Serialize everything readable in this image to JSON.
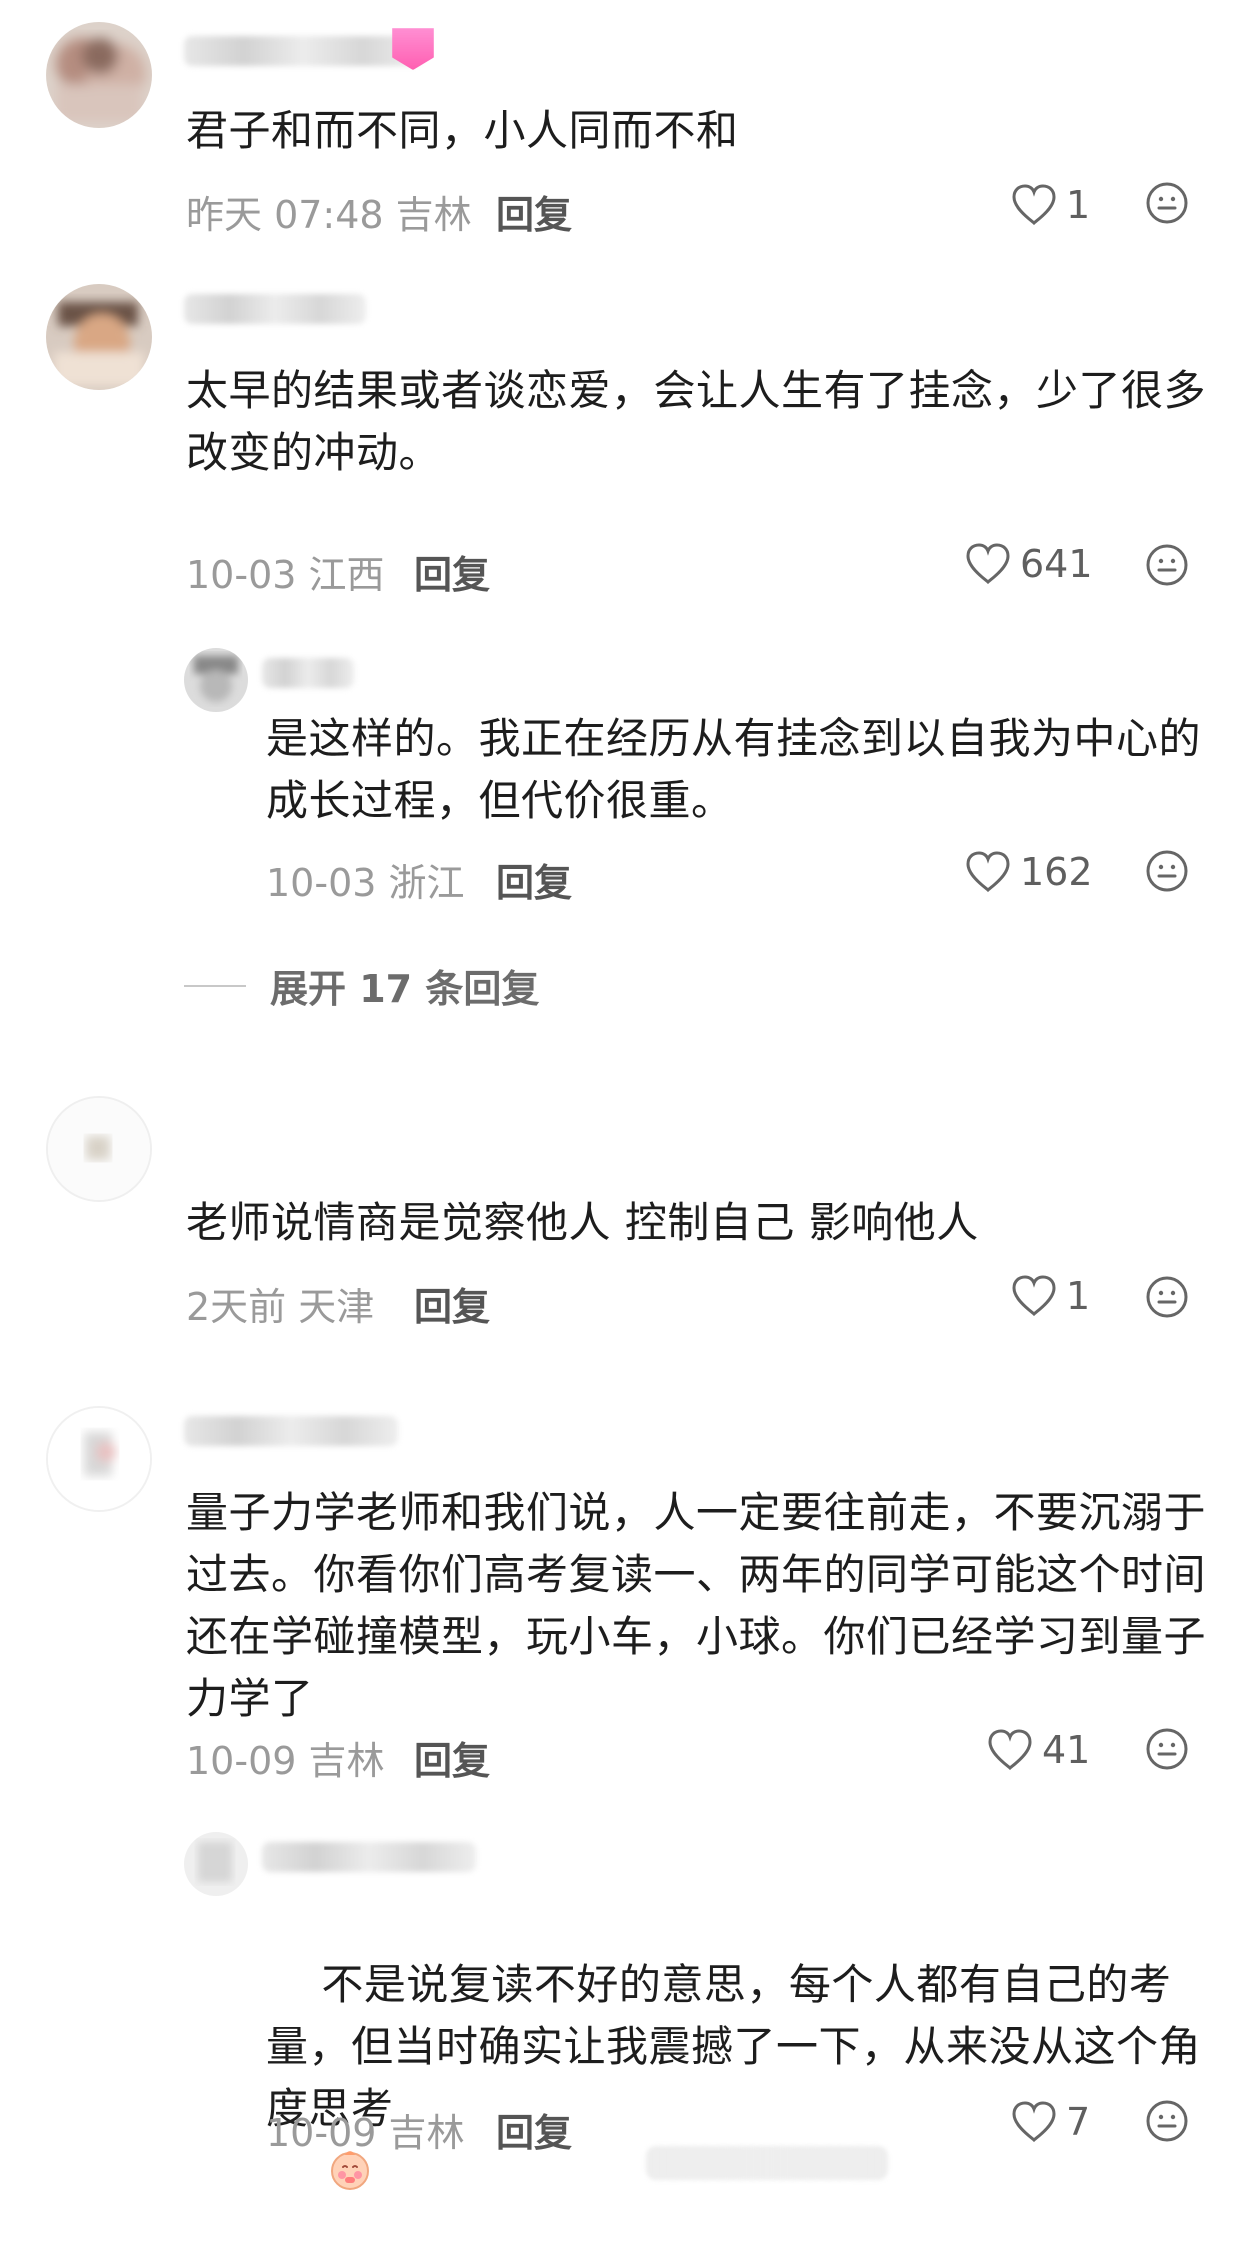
{
  "comments": [
    {
      "text": "君子和而不同，小人同而不和",
      "meta": "昨天 07:48 吉林",
      "reply": "回复",
      "likes": "1"
    },
    {
      "text": "太早的结果或者谈恋爱，会让人生有了挂念，少了很多改变的冲动。",
      "meta": "10-03 江西",
      "reply": "回复",
      "likes": "641",
      "replies": [
        {
          "text": "是这样的。我正在经历从有挂念到以自我为中心的成长过程，但代价很重。",
          "meta": "10-03 浙江",
          "reply": "回复",
          "likes": "162"
        }
      ],
      "expand_label": "展开 17 条回复"
    },
    {
      "text": "老师说情商是觉察他人 控制自己 影响他人",
      "meta": "2天前 天津",
      "reply": "回复",
      "likes": "1"
    },
    {
      "text": "量子力学老师和我们说，人一定要往前走，不要沉溺于过去。你看你们高考复读一、两年的同学可能这个时间还在学碰撞模型，玩小车，小球。你们已经学习到量子力学了",
      "meta": "10-09 吉林",
      "reply": "回复",
      "likes": "41",
      "replies": [
        {
          "text": "不是说复读不好的意思，每个人都有自己的考量，但当时确实让我震撼了一下，从来没从这个角度思考",
          "meta": "10-09 吉林",
          "reply": "回复",
          "likes": "7"
        }
      ]
    }
  ],
  "icons": {
    "like": "heart-outline-icon",
    "reaction": "smile-face-icon",
    "emoji": "blush-emoji-icon"
  },
  "colors": {
    "text": "#1d1d1d",
    "meta": "#9a9a9a",
    "reply": "#555555",
    "badge": "#ff5fb1"
  }
}
